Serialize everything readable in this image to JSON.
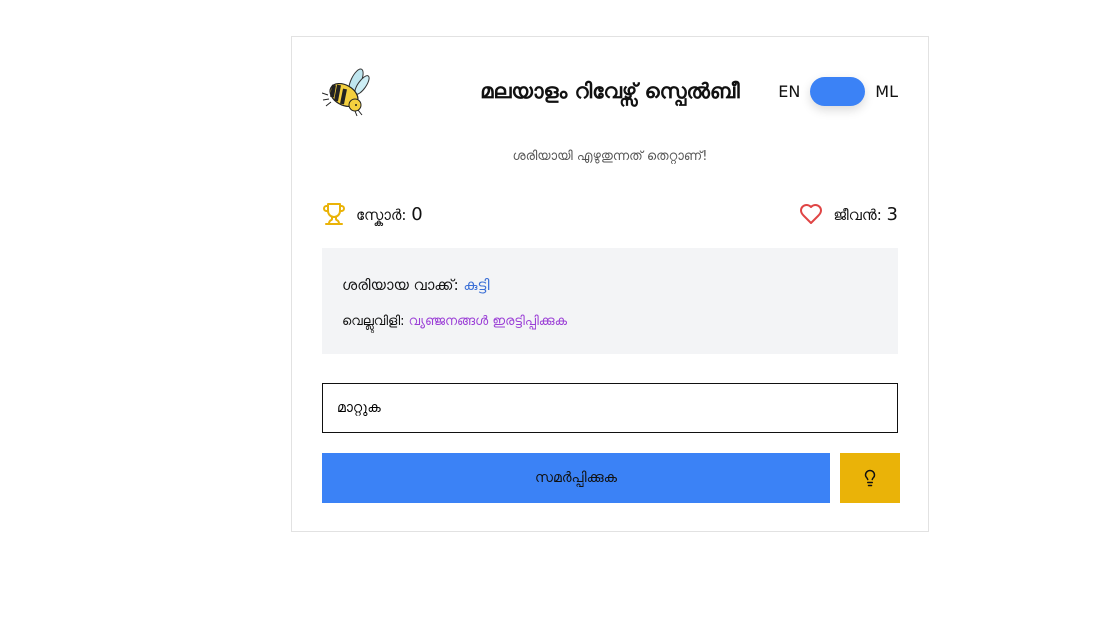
{
  "header": {
    "title": "മലയാളം റിവേഴ്സ് സ്പെൽബീ",
    "lang_en": "EN",
    "lang_ml": "ML",
    "logo_icon": "bee-icon"
  },
  "subtitle": "ശരിയായി എഴുതുന്നത് തെറ്റാണ്!",
  "stats": {
    "score_label": "സ്കോർ:",
    "score_value": "0",
    "lives_label": "ജീവൻ:",
    "lives_value": "3"
  },
  "info": {
    "correct_label": "ശരിയായ വാക്ക്:",
    "correct_word": "കുട്ടി",
    "challenge_label": "വെല്ലുവിളി:",
    "challenge_value": "വ്യഞ്ജനങ്ങൾ ഇരട്ടിപ്പിക്കുക"
  },
  "input": {
    "value": "മാറ്റുക"
  },
  "buttons": {
    "submit": "സമർപ്പിക്കുക",
    "hint_icon": "lightbulb-icon"
  },
  "colors": {
    "accent": "#3b82f6",
    "hint": "#eab308",
    "trophy": "#eab308",
    "heart": "#e04545"
  }
}
